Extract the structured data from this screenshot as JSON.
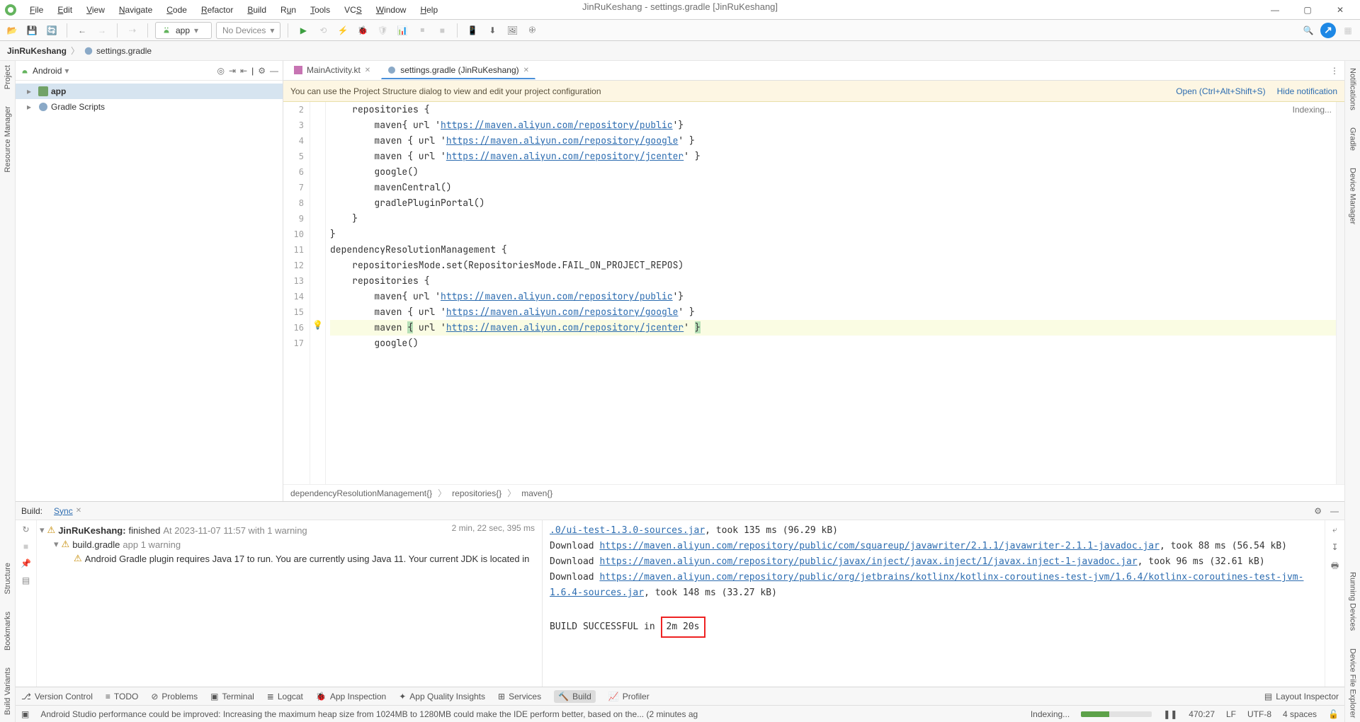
{
  "window": {
    "title": "JinRuKeshang - settings.gradle [JinRuKeshang]"
  },
  "menu": {
    "file": "File",
    "edit": "Edit",
    "view": "View",
    "navigate": "Navigate",
    "code": "Code",
    "refactor": "Refactor",
    "build": "Build",
    "run": "Run",
    "tools": "Tools",
    "vcs": "VCS",
    "window": "Window",
    "help": "Help"
  },
  "toolbar": {
    "run_config": "app",
    "devices": "No Devices",
    "devices_icon": "▾"
  },
  "breadcrumb": {
    "project": "JinRuKeshang",
    "file": "settings.gradle"
  },
  "rails": {
    "left": [
      "Project",
      "Resource Manager",
      "Structure",
      "Bookmarks",
      "Build Variants"
    ],
    "right": [
      "Notifications",
      "Gradle",
      "Device Manager",
      "Running Devices",
      "Device File Explorer"
    ]
  },
  "project": {
    "view": "Android",
    "nodes": {
      "app": "app",
      "gradle_scripts": "Gradle Scripts"
    }
  },
  "tabs": {
    "t1": "MainActivity.kt",
    "t2": "settings.gradle (JinRuKeshang)"
  },
  "notice": {
    "msg": "You can use the Project Structure dialog to view and edit your project configuration",
    "open": "Open (Ctrl+Alt+Shift+S)",
    "hide": "Hide notification"
  },
  "editor": {
    "indexing_pill": "Indexing...",
    "lines": [
      "2",
      "3",
      "4",
      "5",
      "6",
      "7",
      "8",
      "9",
      "10",
      "11",
      "12",
      "13",
      "14",
      "15",
      "16",
      "17"
    ],
    "code": {
      "l2": "    repositories {",
      "l3a": "        maven{ url '",
      "l3u": "https://maven.aliyun.com/repository/public",
      "l3z": "'}",
      "l4a": "        maven { url '",
      "l4u": "https://maven.aliyun.com/repository/google",
      "l4z": "' }",
      "l5a": "        maven { url '",
      "l5u": "https://maven.aliyun.com/repository/jcenter",
      "l5z": "' }",
      "l6": "        google()",
      "l7": "        mavenCentral()",
      "l8": "        gradlePluginPortal()",
      "l9": "    }",
      "l10": "}",
      "l11": "dependencyResolutionManagement {",
      "l12": "    repositoriesMode.set(RepositoriesMode.FAIL_ON_PROJECT_REPOS)",
      "l13": "    repositories {",
      "l14a": "        maven{ url '",
      "l14u": "https://maven.aliyun.com/repository/public",
      "l14z": "'}",
      "l15a": "        maven { url '",
      "l15u": "https://maven.aliyun.com/repository/google",
      "l15z": "' }",
      "l16a": "        maven ",
      "l16b": "{",
      "l16c": " url '",
      "l16u": "https://maven.aliyun.com/repository/jcenter",
      "l16d": "' ",
      "l16e": "}",
      "l17": "        google()"
    },
    "crumbs": {
      "c1": "dependencyResolutionManagement{}",
      "c2": "repositories{}",
      "c3": "maven{}"
    }
  },
  "build": {
    "tab_label": "Build:",
    "sync": "Sync",
    "root_label": "JinRuKeshang:",
    "root_status": "finished",
    "root_time": "At 2023-11-07 11:57 with 1 warning",
    "duration": "2 min, 22 sec, 395 ms",
    "child_file": "build.gradle",
    "child_note": "app 1 warning",
    "warning": "Android Gradle plugin requires Java 17 to run. You are currently using Java 11. Your current JDK is located in",
    "log": {
      "l1a": ".0/ui-test-1.3.0-sources.jar",
      "l1b": ", took 135 ms (96.29 kB)",
      "l2a": "Download ",
      "l2u": "https://maven.aliyun.com/repository/public/com/squareup/javawriter/2.1.1/javawriter-2.1.1-javadoc.jar",
      "l2b": ", took 88 ms (56.54 kB)",
      "l3a": "Download ",
      "l3u": "https://maven.aliyun.com/repository/public/javax/inject/javax.inject/1/javax.inject-1-javadoc.jar",
      "l3b": ", took 96 ms (32.61 kB)",
      "l4a": "Download ",
      "l4u": "https://maven.aliyun.com/repository/public/org/jetbrains/kotlinx/kotlinx-coroutines-test-jvm/1.6.4/kotlinx-coroutines-test-jvm-1.6.4-sources.jar",
      "l4b": ", took 148 ms (33.27 kB)",
      "l5": "BUILD SUCCESSFUL in ",
      "l5box": "2m 20s"
    }
  },
  "tools": {
    "version_control": "Version Control",
    "todo": "TODO",
    "problems": "Problems",
    "terminal": "Terminal",
    "logcat": "Logcat",
    "app_inspection": "App Inspection",
    "app_quality": "App Quality Insights",
    "services": "Services",
    "build": "Build",
    "profiler": "Profiler",
    "layout_inspector": "Layout Inspector"
  },
  "status": {
    "perf_msg": "Android Studio performance could be improved: Increasing the maximum heap size from 1024MB to 1280MB could make the IDE perform better, based on the... (2 minutes ag",
    "indexing": "Indexing...",
    "caret": "470:27",
    "line_sep": "LF",
    "encoding": "UTF-8",
    "indent": "4 spaces"
  }
}
